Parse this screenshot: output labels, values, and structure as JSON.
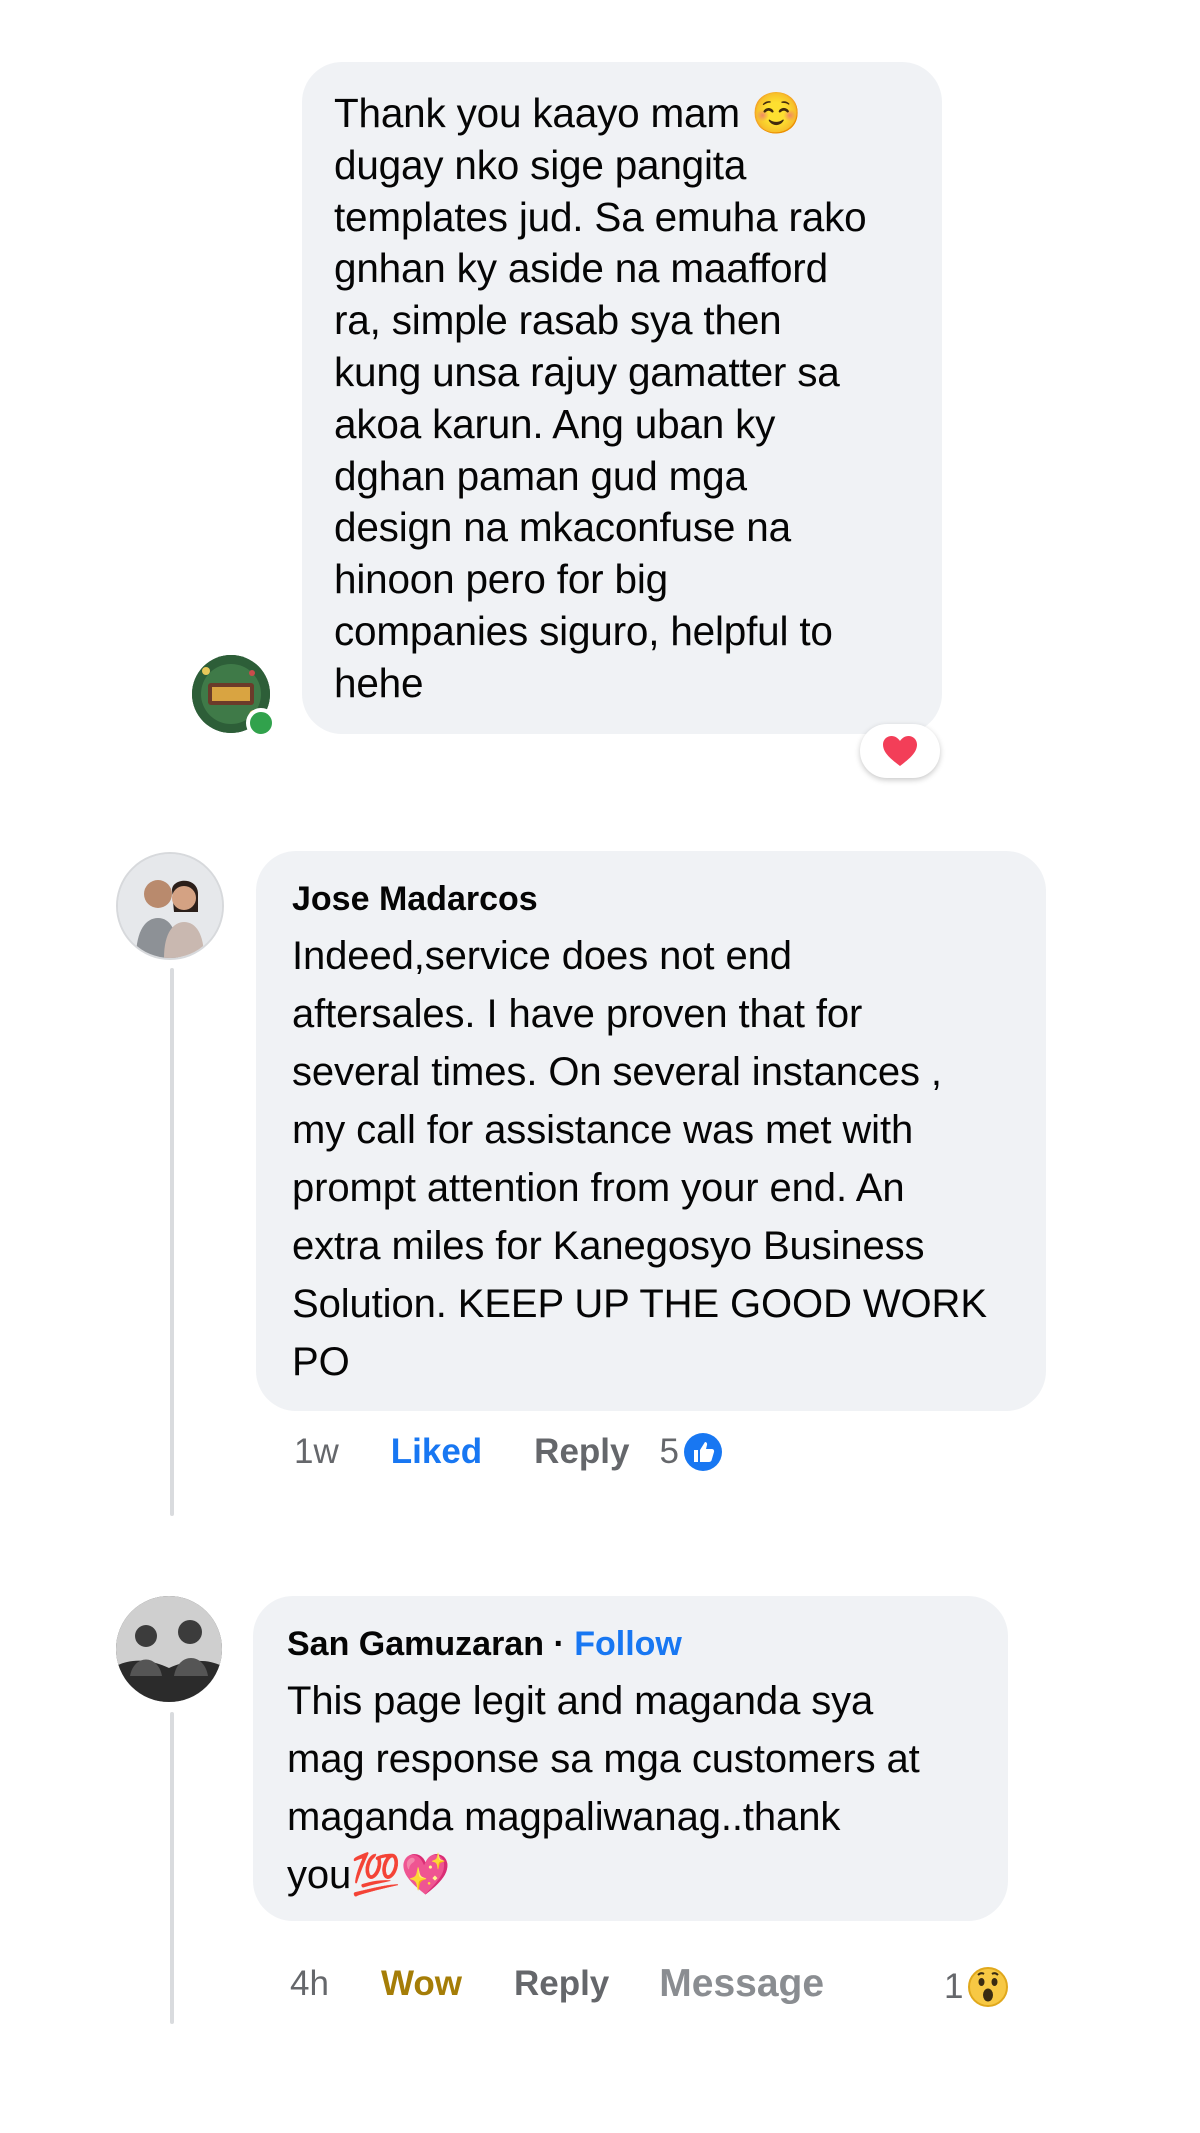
{
  "reply_top": {
    "text": "Thank you kaayo mam ☺️\ndugay nko sige pangita\ntemplates jud. Sa emuha rako\ngnhan ky aside na maafford\nra, simple rasab sya then\nkung unsa rajuy gamatter sa\nakoa karun. Ang uban ky\ndghan paman gud mga\ndesign na mkaconfuse na\nhinoon pero for big\ncompanies siguro, helpful to\nhehe",
    "reaction_icon": "heart-reaction-icon",
    "reaction_color": "#f33e58"
  },
  "comment_jose": {
    "author": "Jose Madarcos",
    "text": "Indeed,service does  not end\naftersales. I have proven that for\nseveral times. On several instances ,\nmy call  for assistance was met with\nprompt attention from your  end. An\nextra miles for Kanegosyo Business\nSolution. KEEP UP THE GOOD WORK\nPO",
    "time": "1w",
    "like_label": "Liked",
    "reply_label": "Reply",
    "reaction_count": "5",
    "reaction_icon": "like-reaction-icon"
  },
  "comment_san": {
    "author": "San Gamuzaran",
    "separator": "·",
    "follow_label": "Follow",
    "text": "This page legit and maganda sya\nmag response sa mga customers at\nmaganda magpaliwanag..thank\nyou💯💖",
    "time": "4h",
    "reaction_label": "Wow",
    "reply_label": "Reply",
    "message_label": "Message",
    "reaction_count": "1",
    "reaction_icon": "wow-reaction-icon"
  },
  "colors": {
    "bubble": "#f0f2f5",
    "link_blue": "#1877f2",
    "muted": "#65676b",
    "wow": "#a57d07",
    "online": "#31a24c"
  }
}
